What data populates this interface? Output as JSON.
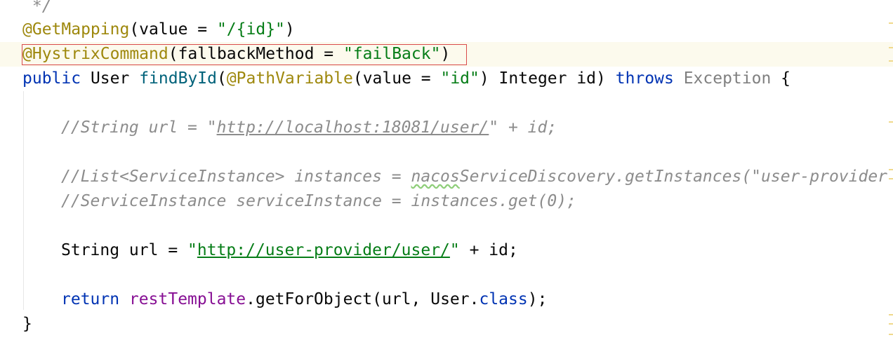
{
  "code": {
    "line_comment_end": " */",
    "line1": {
      "annotation": "@GetMapping",
      "open": "(value = ",
      "string": "\"/{id}\"",
      "close": ")"
    },
    "line2": {
      "annotation": "@HystrixCommand",
      "open": "(fallbackMethod = ",
      "string": "\"failBack\"",
      "close": ")"
    },
    "line3": {
      "kw_public": "public",
      "type_user": " User ",
      "method": "findById",
      "paren_open": "(",
      "annotation": "@PathVariable",
      "args_open": "(value = ",
      "string": "\"id\"",
      "args_close": ") Integer id) ",
      "kw_throws": "throws",
      "space": " ",
      "exception": "Exception",
      "brace": " {"
    },
    "line4": {
      "prefix": "//String url = \"",
      "url": "http://localhost:18081/user/",
      "suffix": "\" + id;"
    },
    "line5": {
      "prefix": "//List<ServiceInstance> instances = ",
      "typo_word": "nacos",
      "suffix": "ServiceDiscovery.getInstances(\"user-provider"
    },
    "line6": {
      "text": "//ServiceInstance serviceInstance = instances.get(0);"
    },
    "line7": {
      "decl": "String url = ",
      "quote_open": "\"",
      "url": "http://user-provider/user/",
      "quote_close": "\"",
      "suffix": " + id;"
    },
    "line8": {
      "kw_return": "return",
      "space": " ",
      "field": "restTemplate",
      "call": ".getForObject(url, User.",
      "kw_class": "class",
      "end": ");"
    },
    "line9": {
      "brace": "}"
    }
  },
  "colors": {
    "keyword": "#0033b3",
    "annotation": "#9e880d",
    "string": "#067d17",
    "method": "#00627a",
    "field": "#871094",
    "comment": "#8c8c8c",
    "highlight_box": "#d94b4b"
  }
}
